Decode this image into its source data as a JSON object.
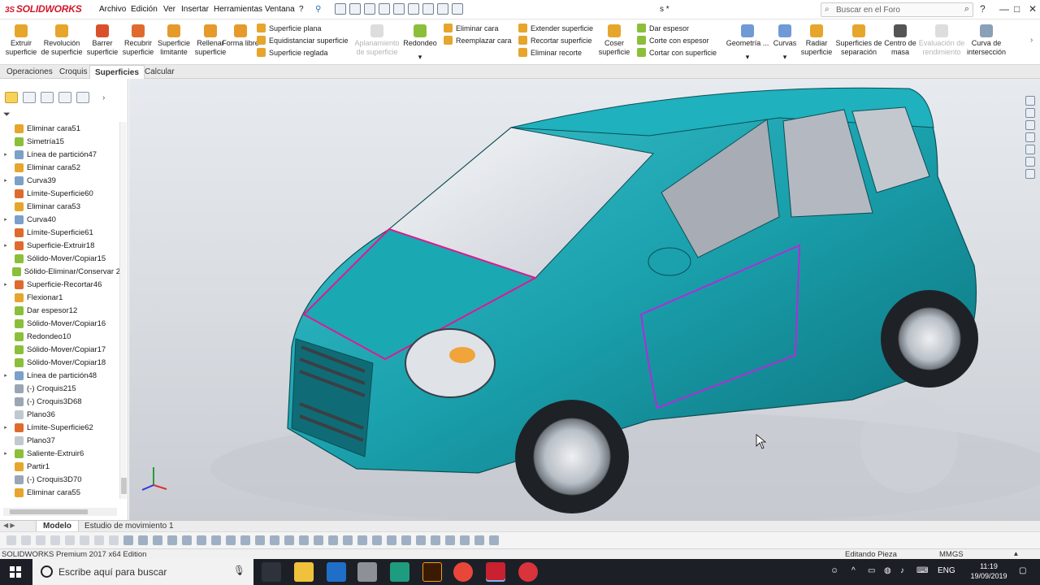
{
  "app": {
    "logo_text": "SOLIDWORKS",
    "doc_title": "s *"
  },
  "menu": [
    "Archivo",
    "Edición",
    "Ver",
    "Insertar",
    "Herramientas",
    "Ventana",
    "?"
  ],
  "search": {
    "placeholder": "Buscar en el Foro"
  },
  "window_controls": {
    "help": "?",
    "minimize": "—",
    "maximize": "□",
    "close": "✕"
  },
  "ribbon": {
    "extruir": "Extruir superficie",
    "revolucion": "Revolución de superficie",
    "barrer": "Barrer superficie",
    "recubrir": "Recubrir superficie",
    "limitante": "Superficie limitante",
    "rellenar": "Rellenar superficie",
    "forma_libre": "Forma libre",
    "superficie_plana": "Superficie plana",
    "equidistanciar": "Equidistanciar superficie",
    "superficie_reglada": "Superficie reglada",
    "aplanamiento": "Aplanamiento de superficie",
    "redondeo": "Redondeo",
    "eliminar_cara": "Eliminar cara",
    "reemplazar_cara": "Reemplazar cara",
    "extender": "Extender superficie",
    "recortar": "Recortar superficie",
    "eliminar_recorte": "Eliminar recorte",
    "coser": "Coser superficie",
    "dar_espesor": "Dar espesor",
    "corte_espesor": "Corte con espesor",
    "cortar_superficie": "Cortar con superficie",
    "geometria": "Geometría ...",
    "curvas": "Curvas",
    "radiar": "Radiar superficie",
    "separacion": "Superficies de separación",
    "centro_masa": "Centro de masa",
    "evaluacion": "Evaluación de rendimiento",
    "interseccion": "Curva de intersección"
  },
  "command_tabs": [
    "Operaciones",
    "Croquis",
    "Superficies",
    "Calcular"
  ],
  "tree": [
    "Eliminar cara51",
    "Simetría15",
    "Línea de partición47",
    "Eliminar cara52",
    "Curva39",
    "Límite-Superficie60",
    "Eliminar cara53",
    "Curva40",
    "Límite-Superficie61",
    "Superficie-Extruir18",
    "Sólido-Mover/Copiar15",
    "Sólido-Eliminar/Conservar 2",
    "Superficie-Recortar46",
    "Flexionar1",
    "Dar espesor12",
    "Sólido-Mover/Copiar16",
    "Redondeo10",
    "Sólido-Mover/Copiar17",
    "Sólido-Mover/Copiar18",
    "Línea de partición48",
    "(-) Croquis215",
    "(-) Croquis3D68",
    "Plano36",
    "Límite-Superficie62",
    "Plano37",
    "Saliente-Extruir6",
    "Partir1",
    "(-) Croquis3D70",
    "Eliminar cara55"
  ],
  "bottom_tabs": [
    "Modelo",
    "Estudio de movimiento 1"
  ],
  "status": {
    "edition": "SOLIDWORKS Premium 2017 x64 Edition",
    "mode": "Editando Pieza",
    "units": "MMGS"
  },
  "taskbar": {
    "search_placeholder": "Escribe aquí para buscar",
    "lang": "ENG",
    "time": "11:19",
    "date": "19/09/2019"
  },
  "colors": {
    "car_body": "#1aa1ad",
    "highlight_edge": "#e0198f",
    "brand": "#d2182a"
  }
}
